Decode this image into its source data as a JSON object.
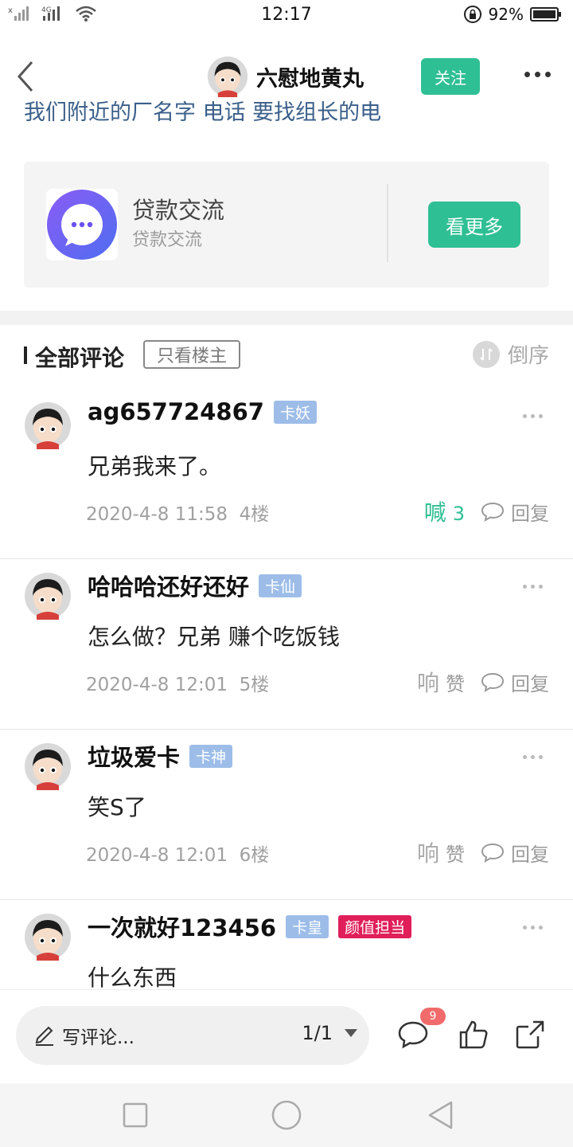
{
  "status_bar": {
    "time": "12:17",
    "network": "4G",
    "battery_percent": "92%",
    "icons": [
      "signal-x-icon",
      "signal-4g-icon",
      "wifi-icon",
      "rotation-lock-icon",
      "battery-icon"
    ]
  },
  "header": {
    "author_name": "六慰地黄丸",
    "follow_label": "关注",
    "icons": [
      "back-chevron-icon",
      "more-dots-icon"
    ]
  },
  "post": {
    "cut_text": "我们附近的厂名字 电话 要找组长的电"
  },
  "group_card": {
    "title": "贷款交流",
    "subtitle": "贷款交流",
    "button_label": "看更多",
    "icon": "chat-bubble-icon",
    "icon_color": "#6b4ff0"
  },
  "comments_header": {
    "title": "全部评论",
    "only_owner_label": "只看楼主",
    "sort_label": "倒序"
  },
  "comments": [
    {
      "name": "ag657724867",
      "badges": [
        {
          "text": "卡妖",
          "type": "level"
        }
      ],
      "text": "兄弟我来了。",
      "date": "2020-4-8 11:58",
      "floor": "4楼",
      "like_glyph": "喊",
      "like_count": "3",
      "liked": true,
      "reply_label": "回复"
    },
    {
      "name": "哈哈哈还好还好",
      "badges": [
        {
          "text": "卡仙",
          "type": "level"
        }
      ],
      "text": "怎么做？兄弟  赚个吃饭钱",
      "date": "2020-4-8 12:01",
      "floor": "5楼",
      "like_glyph": "响",
      "like_count": "赞",
      "liked": false,
      "reply_label": "回复"
    },
    {
      "name": "垃圾爱卡",
      "badges": [
        {
          "text": "卡神",
          "type": "level"
        }
      ],
      "text": "笑S了",
      "date": "2020-4-8 12:01",
      "floor": "6楼",
      "like_glyph": "响",
      "like_count": "赞",
      "liked": false,
      "reply_label": "回复"
    },
    {
      "name": "一次就好123456",
      "badges": [
        {
          "text": "卡皇",
          "type": "level"
        },
        {
          "text": "颜值担当",
          "type": "special"
        }
      ],
      "text": "什么东西",
      "date": "",
      "floor": "",
      "like_glyph": "",
      "like_count": "",
      "liked": false,
      "reply_label": ""
    }
  ],
  "bottom_bar": {
    "write_placeholder": "写评论...",
    "page_indicator": "1/1",
    "comment_count": "9",
    "icons": [
      "pencil-icon",
      "caret-down-icon",
      "comment-icon",
      "thumbs-up-icon",
      "share-icon"
    ]
  },
  "nav_bar": {
    "icons": [
      "recents-square-icon",
      "home-circle-icon",
      "back-triangle-icon"
    ]
  },
  "colors": {
    "accent_green": "#2fbf94",
    "badge_blue": "#9dbde8",
    "badge_red": "#e01e5a",
    "count_badge": "#f26b6b"
  }
}
